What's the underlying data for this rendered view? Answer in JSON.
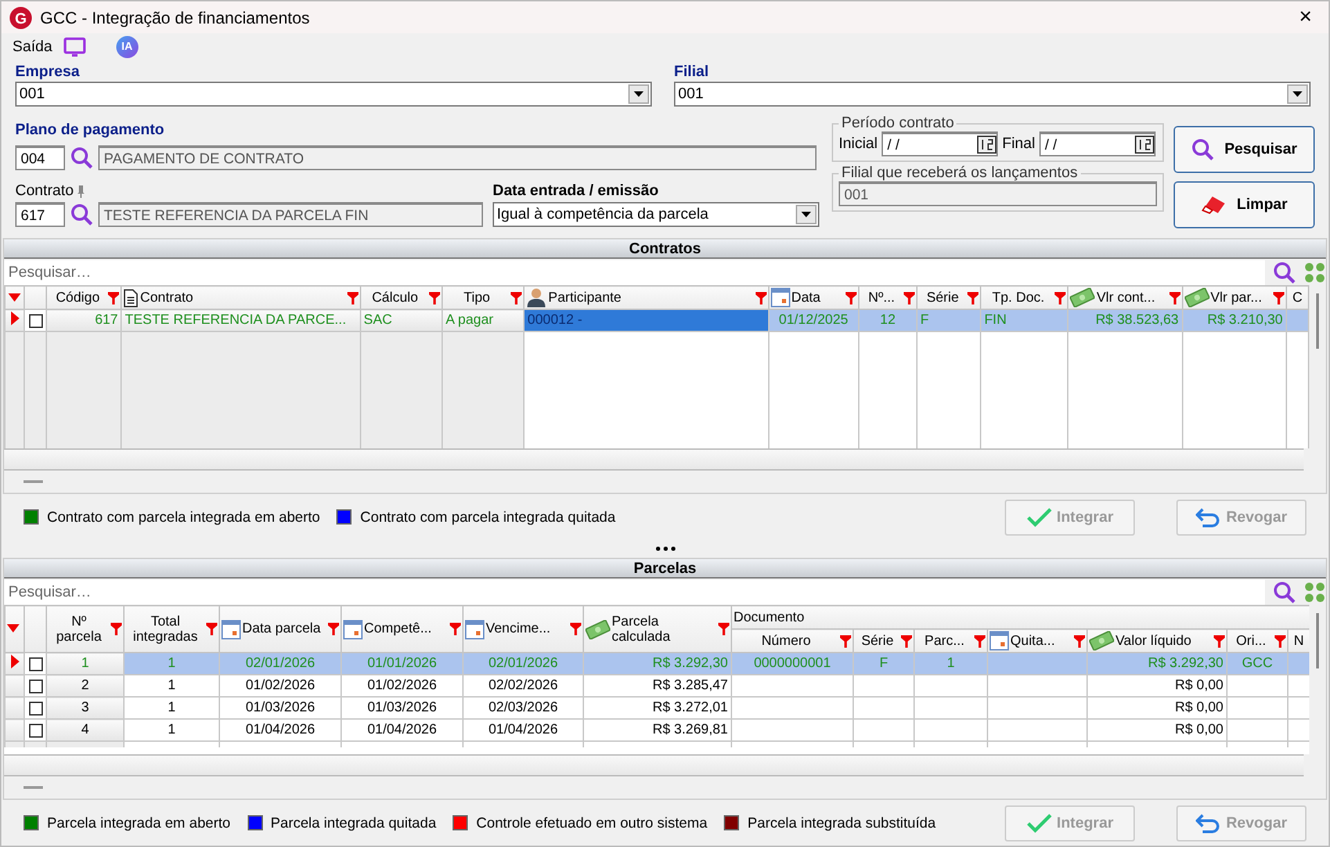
{
  "window": {
    "title": "GCC - Integração de financiamentos",
    "logo": "G",
    "close_glyph": "×"
  },
  "toolbar": {
    "label": "Saída",
    "ia_badge": "IA"
  },
  "form": {
    "empresa": {
      "label": "Empresa",
      "value": "001"
    },
    "filial": {
      "label": "Filial",
      "value": "001"
    },
    "plano": {
      "label": "Plano de pagamento",
      "code": "004",
      "description": "PAGAMENTO DE CONTRATO"
    },
    "contrato": {
      "label": "Contrato",
      "code": "617",
      "description": "TESTE REFERENCIA DA PARCELA FIN"
    },
    "data_entrada": {
      "label": "Data entrada / emissão",
      "value": "Igual à competência da parcela"
    },
    "periodo": {
      "legend": "Período contrato",
      "inicial_label": "Inicial",
      "inicial_value": "/ /",
      "final_label": "Final",
      "final_value": "/ /"
    },
    "filial_lancamentos": {
      "legend": "Filial que receberá os lançamentos",
      "value": "001"
    },
    "buttons": [
      {
        "label": "Pesquisar",
        "kind": "search"
      },
      {
        "label": "Limpar",
        "kind": "clear"
      }
    ]
  },
  "contratos": {
    "title": "Contratos",
    "search_placeholder": "Pesquisar…",
    "columns": [
      {
        "label": "Código",
        "kind": "plain",
        "filter": true
      },
      {
        "label": "Contrato",
        "kind": "document",
        "filter": true
      },
      {
        "label": "Cálculo",
        "kind": "plain",
        "filter": true
      },
      {
        "label": "Tipo",
        "kind": "plain",
        "filter": true
      },
      {
        "label": "Participante",
        "kind": "person",
        "filter": true
      },
      {
        "label": "Data",
        "kind": "calendar",
        "filter": true
      },
      {
        "label": "Nº...",
        "kind": "plain",
        "filter": true
      },
      {
        "label": "Série",
        "kind": "plain",
        "filter": true
      },
      {
        "label": "Tp. Doc.",
        "kind": "plain",
        "filter": true
      },
      {
        "label": "Vlr cont...",
        "kind": "money",
        "filter": true
      },
      {
        "label": "Vlr par...",
        "kind": "money",
        "filter": true
      },
      {
        "label": "C",
        "kind": "plain",
        "filter": false
      }
    ],
    "rows": [
      {
        "selected": true,
        "checked": false,
        "integrated": true,
        "cells": [
          {
            "text": "617",
            "focused": false
          },
          {
            "text": "TESTE REFERENCIA DA PARCE...",
            "focused": false
          },
          {
            "text": "SAC",
            "focused": false
          },
          {
            "text": "A pagar",
            "focused": false
          },
          {
            "text": "000012 -",
            "focused": true
          },
          {
            "text": "01/12/2025",
            "focused": false
          },
          {
            "text": "12",
            "focused": false
          },
          {
            "text": "F",
            "focused": false
          },
          {
            "text": "FIN",
            "focused": false
          },
          {
            "text": "R$ 38.523,63",
            "focused": false
          },
          {
            "text": "R$ 3.210,30",
            "focused": false
          }
        ]
      }
    ],
    "legend": [
      {
        "label": "Contrato com parcela integrada em aberto",
        "color": "#008000"
      },
      {
        "label": "Contrato com parcela integrada quitada",
        "color": "#0000ff"
      }
    ],
    "buttons": [
      {
        "label": "Integrar",
        "kind": "integrate",
        "disabled": true
      },
      {
        "label": "Revogar",
        "kind": "revoke",
        "disabled": true
      }
    ]
  },
  "parcelas": {
    "title": "Parcelas",
    "search_placeholder": "Pesquisar…",
    "columns": [
      {
        "label": "Nº parcela",
        "kind": "plain",
        "filter": true
      },
      {
        "label": "Total integradas",
        "kind": "plain",
        "filter": true
      },
      {
        "label": "Data parcela",
        "kind": "calendar",
        "filter": true
      },
      {
        "label": "Competê...",
        "kind": "calendar",
        "filter": true
      },
      {
        "label": "Vencime...",
        "kind": "calendar",
        "filter": true
      },
      {
        "label": "Parcela calculada",
        "kind": "money",
        "filter": true
      }
    ],
    "group": {
      "label": "Documento",
      "columns": [
        {
          "label": "Número",
          "kind": "plain",
          "filter": true
        },
        {
          "label": "Série",
          "kind": "plain",
          "filter": true
        },
        {
          "label": "Parc...",
          "kind": "plain",
          "filter": true
        },
        {
          "label": "Quita...",
          "kind": "calendar",
          "filter": true
        },
        {
          "label": "Valor líquido",
          "kind": "money",
          "filter": true
        },
        {
          "label": "Ori...",
          "kind": "plain",
          "filter": true
        },
        {
          "label": "N",
          "kind": "plain",
          "filter": false
        }
      ]
    },
    "rows": [
      {
        "selected": true,
        "checked": false,
        "integrated": true,
        "cells": [
          "1",
          "1",
          "02/01/2026",
          "01/01/2026",
          "02/01/2026",
          "R$ 3.292,30",
          "0000000001",
          "F",
          "1",
          null,
          "R$ 3.292,30",
          "GCC"
        ]
      },
      {
        "selected": false,
        "checked": false,
        "integrated": false,
        "cells": [
          "2",
          "1",
          "01/02/2026",
          "01/02/2026",
          "02/02/2026",
          "R$ 3.285,47",
          null,
          null,
          null,
          null,
          "R$ 0,00",
          null
        ]
      },
      {
        "selected": false,
        "checked": false,
        "integrated": false,
        "cells": [
          "3",
          "1",
          "01/03/2026",
          "01/03/2026",
          "02/03/2026",
          "R$ 3.272,01",
          null,
          null,
          null,
          null,
          "R$ 0,00",
          null
        ]
      },
      {
        "selected": false,
        "checked": false,
        "integrated": false,
        "cells": [
          "4",
          "1",
          "01/04/2026",
          "01/04/2026",
          "01/04/2026",
          "R$ 3.269,81",
          null,
          null,
          null,
          null,
          "R$ 0,00",
          null
        ]
      }
    ],
    "legend": [
      {
        "label": "Parcela integrada em aberto",
        "color": "#008000"
      },
      {
        "label": "Parcela integrada quitada",
        "color": "#0000ff"
      },
      {
        "label": "Controle efetuado em outro sistema",
        "color": "#ff0000"
      },
      {
        "label": "Parcela integrada substituída",
        "color": "#800000"
      }
    ],
    "buttons": [
      {
        "label": "Integrar",
        "kind": "integrate",
        "disabled": true
      },
      {
        "label": "Revogar",
        "kind": "revoke",
        "disabled": true
      }
    ]
  }
}
